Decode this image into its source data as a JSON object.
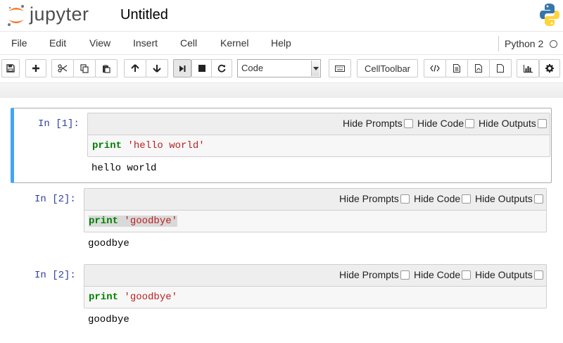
{
  "header": {
    "logo_text": "jupyter",
    "notebook_name": "Untitled",
    "accent": "#f37726"
  },
  "menubar": {
    "items": [
      "File",
      "Edit",
      "View",
      "Insert",
      "Cell",
      "Kernel",
      "Help"
    ],
    "kernel_name": "Python 2"
  },
  "toolbar": {
    "cell_type": "Code",
    "celltoolbar_label": "CellToolbar",
    "icons": [
      "save-icon",
      "plus-icon",
      "cut-icon",
      "copy-icon",
      "paste-icon",
      "arrow-up-icon",
      "arrow-down-icon",
      "step-forward-icon",
      "stop-icon",
      "restart-icon",
      "keyboard-icon",
      "code-icon",
      "file-icon",
      "pdf-icon",
      "document-icon",
      "bar-chart-icon",
      "gear-icon"
    ]
  },
  "celltoolbar": {
    "hide_prompts": "Hide Prompts",
    "hide_code": "Hide Code",
    "hide_outputs": "Hide Outputs"
  },
  "cells": [
    {
      "prompt": "In [1]:",
      "keyword": "print",
      "string": "'hello world'",
      "output": "hello world",
      "selected": true
    },
    {
      "prompt": "In [2]:",
      "keyword": "print",
      "string": "'goodbye'",
      "output": "goodbye",
      "selected": false
    },
    {
      "prompt": "In [2]:",
      "keyword": "print",
      "string": "'goodbye'",
      "output": "goodbye",
      "selected": false
    }
  ],
  "colors": {
    "selected_border": "#42a5f5",
    "prompt": "#303f9f",
    "keyword": "#008000",
    "string": "#ba2121"
  }
}
